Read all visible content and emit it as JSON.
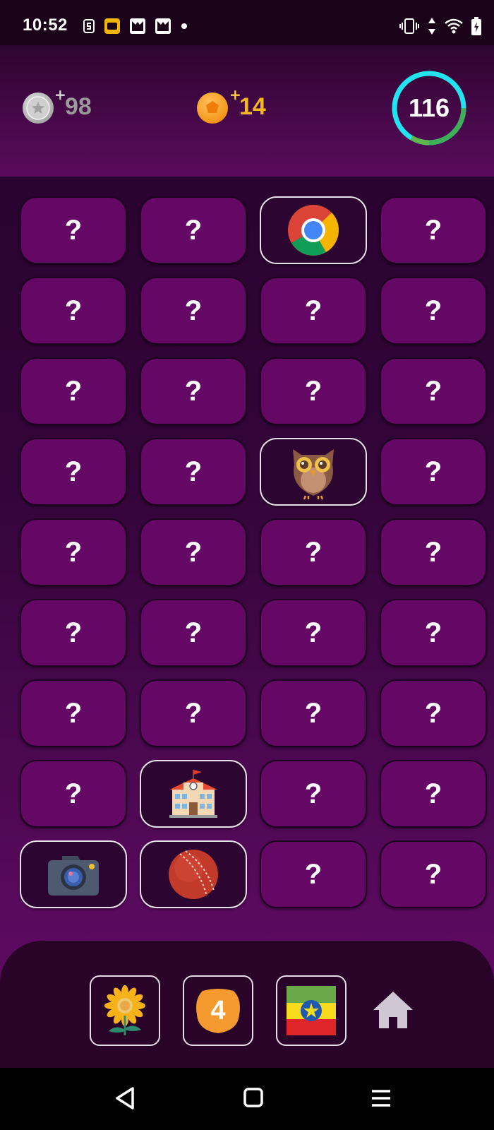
{
  "status_bar": {
    "time": "10:52",
    "left_icons": [
      "s-notification-icon",
      "folder-app-icon",
      "game-app-icon",
      "game-app-icon",
      "more-dot-icon"
    ],
    "right_icons": [
      "vibrate-icon",
      "data-arrows-icon",
      "wifi-icon",
      "battery-icon"
    ]
  },
  "header": {
    "silver": {
      "plus": "+",
      "value": "98"
    },
    "gold": {
      "plus": "+",
      "value": "14"
    },
    "timer": {
      "value": "116",
      "ring_colors": [
        "#22e3ee",
        "#3fae59"
      ]
    }
  },
  "board": {
    "hidden_label": "?",
    "cards": [
      {
        "state": "hidden"
      },
      {
        "state": "hidden"
      },
      {
        "state": "revealed",
        "icon": "chrome-icon"
      },
      {
        "state": "hidden"
      },
      {
        "state": "hidden"
      },
      {
        "state": "hidden"
      },
      {
        "state": "hidden"
      },
      {
        "state": "hidden"
      },
      {
        "state": "hidden"
      },
      {
        "state": "hidden"
      },
      {
        "state": "hidden"
      },
      {
        "state": "hidden"
      },
      {
        "state": "hidden"
      },
      {
        "state": "hidden"
      },
      {
        "state": "revealed",
        "icon": "owl-icon"
      },
      {
        "state": "hidden"
      },
      {
        "state": "hidden"
      },
      {
        "state": "hidden"
      },
      {
        "state": "hidden"
      },
      {
        "state": "hidden"
      },
      {
        "state": "hidden"
      },
      {
        "state": "hidden"
      },
      {
        "state": "hidden"
      },
      {
        "state": "hidden"
      },
      {
        "state": "hidden"
      },
      {
        "state": "hidden"
      },
      {
        "state": "hidden"
      },
      {
        "state": "hidden"
      },
      {
        "state": "hidden"
      },
      {
        "state": "revealed",
        "icon": "school-icon"
      },
      {
        "state": "hidden"
      },
      {
        "state": "hidden"
      },
      {
        "state": "revealed",
        "icon": "camera-icon"
      },
      {
        "state": "revealed",
        "icon": "cricket-ball-icon"
      },
      {
        "state": "hidden"
      },
      {
        "state": "hidden"
      }
    ]
  },
  "tray": {
    "slots": [
      {
        "icon": "sunflower-icon"
      },
      {
        "icon": "number-badge-icon",
        "label": "4"
      },
      {
        "icon": "ethiopia-flag-icon"
      }
    ],
    "home_icon": "home-icon"
  },
  "navbar": {
    "buttons": [
      "back-icon",
      "recents-icon",
      "menu-icon"
    ]
  },
  "colors": {
    "card_hidden": "#650865",
    "card_revealed": "#2c0530",
    "silver_text": "#9a9a9a",
    "gold_text": "#f2b81c"
  }
}
